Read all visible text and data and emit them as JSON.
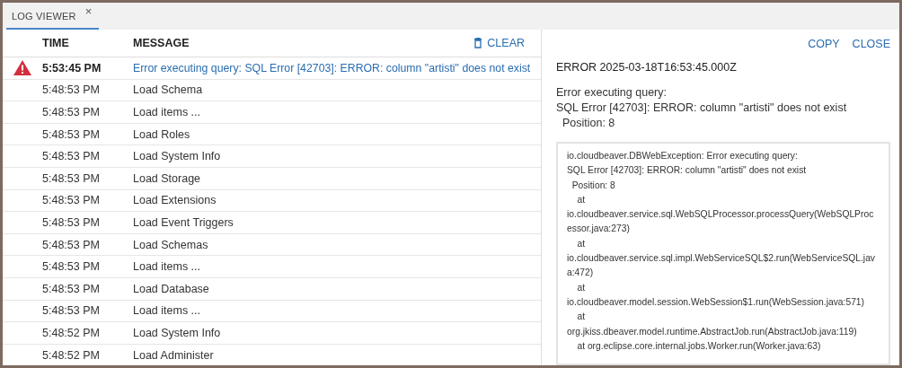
{
  "tabs": [
    {
      "label": "LOG VIEWER",
      "close": "×",
      "selected": true
    }
  ],
  "table": {
    "columns": [
      "TIME",
      "MESSAGE"
    ],
    "clear_button": "CLEAR",
    "rows": [
      {
        "kind": "error",
        "time": "5:53:45 PM",
        "message": "Error executing query: SQL Error [42703]: ERROR: column \"artisti\" does not exist"
      },
      {
        "kind": "info",
        "time": "5:48:53 PM",
        "message": "Load Schema"
      },
      {
        "kind": "info",
        "time": "5:48:53 PM",
        "message": "Load items ..."
      },
      {
        "kind": "info",
        "time": "5:48:53 PM",
        "message": "Load Roles"
      },
      {
        "kind": "info",
        "time": "5:48:53 PM",
        "message": "Load System Info"
      },
      {
        "kind": "info",
        "time": "5:48:53 PM",
        "message": "Load Storage"
      },
      {
        "kind": "info",
        "time": "5:48:53 PM",
        "message": "Load Extensions"
      },
      {
        "kind": "info",
        "time": "5:48:53 PM",
        "message": "Load Event Triggers"
      },
      {
        "kind": "info",
        "time": "5:48:53 PM",
        "message": "Load Schemas"
      },
      {
        "kind": "info",
        "time": "5:48:53 PM",
        "message": "Load items ..."
      },
      {
        "kind": "info",
        "time": "5:48:53 PM",
        "message": "Load Database"
      },
      {
        "kind": "info",
        "time": "5:48:53 PM",
        "message": "Load items ..."
      },
      {
        "kind": "info",
        "time": "5:48:52 PM",
        "message": "Load System Info"
      },
      {
        "kind": "info",
        "time": "5:48:52 PM",
        "message": "Load Administer"
      }
    ]
  },
  "details": {
    "buttons": [
      "COPY",
      "CLOSE"
    ],
    "title": "ERROR 2025-03-18T16:53:45.000Z",
    "message_lines": [
      "Error executing query:",
      "SQL Error [42703]: ERROR: column \"artisti\" does not exist",
      "  Position: 8"
    ],
    "stack_trace": [
      "io.cloudbeaver.DBWebException: Error executing query:",
      "SQL Error [42703]: ERROR: column \"artisti\" does not exist",
      "  Position: 8",
      "    at",
      "io.cloudbeaver.service.sql.WebSQLProcessor.processQuery(WebSQLProc",
      "essor.java:273)",
      "    at",
      "io.cloudbeaver.service.sql.impl.WebServiceSQL$2.run(WebServiceSQL.jav",
      "a:472)",
      "    at",
      "io.cloudbeaver.model.session.WebSession$1.run(WebSession.java:571)",
      "    at",
      "org.jkiss.dbeaver.model.runtime.AbstractJob.run(AbstractJob.java:119)",
      "    at org.eclipse.core.internal.jobs.Worker.run(Worker.java:63)"
    ]
  }
}
